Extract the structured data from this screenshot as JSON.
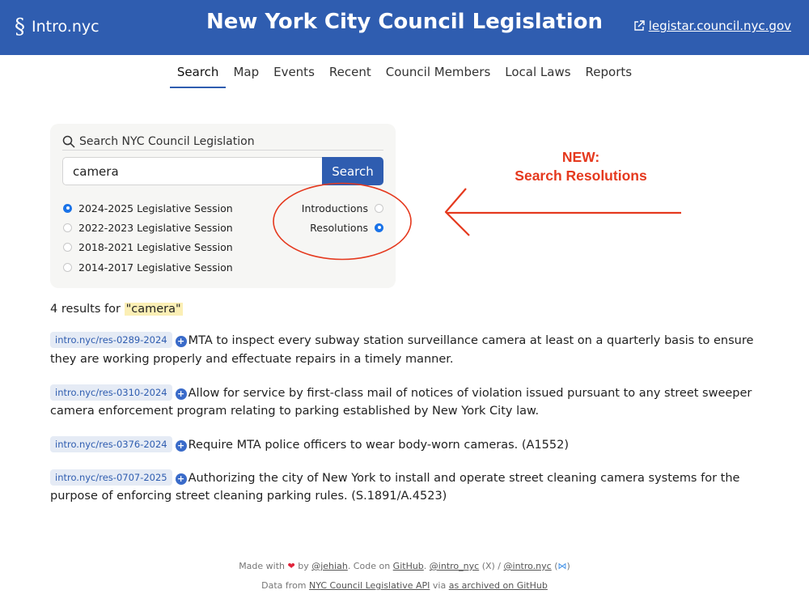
{
  "header": {
    "brand": "Intro.nyc",
    "brand_icon": "section-icon",
    "title": "New York City Council Legislation",
    "external_link": "legistar.council.nyc.gov",
    "bg_color": "#2f5db0"
  },
  "nav": {
    "tabs": [
      {
        "label": "Search",
        "active": true
      },
      {
        "label": "Map"
      },
      {
        "label": "Events"
      },
      {
        "label": "Recent"
      },
      {
        "label": "Council Members"
      },
      {
        "label": "Local Laws"
      },
      {
        "label": "Reports"
      }
    ]
  },
  "search": {
    "heading": "Search NYC Council Legislation",
    "value": "camera",
    "button": "Search",
    "sessions": [
      {
        "label": "2024-2025 Legislative Session",
        "checked": true
      },
      {
        "label": "2022-2023 Legislative Session",
        "checked": false
      },
      {
        "label": "2018-2021 Legislative Session",
        "checked": false
      },
      {
        "label": "2014-2017 Legislative Session",
        "checked": false
      }
    ],
    "types": [
      {
        "label": "Introductions",
        "checked": false
      },
      {
        "label": "Resolutions",
        "checked": true
      }
    ]
  },
  "annotation": {
    "line1": "NEW:",
    "line2": "Search Resolutions",
    "color": "#e5391e"
  },
  "results": {
    "count_prefix": "4 results for ",
    "query": "\"camera\"",
    "items": [
      {
        "id": "intro.nyc/res-0289-2024",
        "text": "MTA to inspect every subway station surveillance camera at least on a quarterly basis to ensure they are working properly and effectuate repairs in a timely manner."
      },
      {
        "id": "intro.nyc/res-0310-2024",
        "text": "Allow for service by first-class mail of notices of violation issued pursuant to any street sweeper camera enforcement program relating to parking established by New York City law."
      },
      {
        "id": "intro.nyc/res-0376-2024",
        "text": "Require MTA police officers to wear body-worn cameras. (A1552)"
      },
      {
        "id": "intro.nyc/res-0707-2025",
        "text": "Authorizing the city of New York to install and operate street cleaning camera systems for the purpose of enforcing street cleaning parking rules. (S.1891/A.4523)"
      }
    ]
  },
  "footer": {
    "made_with": "Made with",
    "by": "by",
    "author": "@jehiah",
    "code_on": ". Code on",
    "github": "GitHub",
    "twitter": "@intro_nyc",
    "x_label": "(X) /",
    "bluesky": "@intro.nyc",
    "data_from": "Data from",
    "api": "NYC Council Legislative API",
    "via": "via",
    "archive": "as archived on GitHub"
  }
}
